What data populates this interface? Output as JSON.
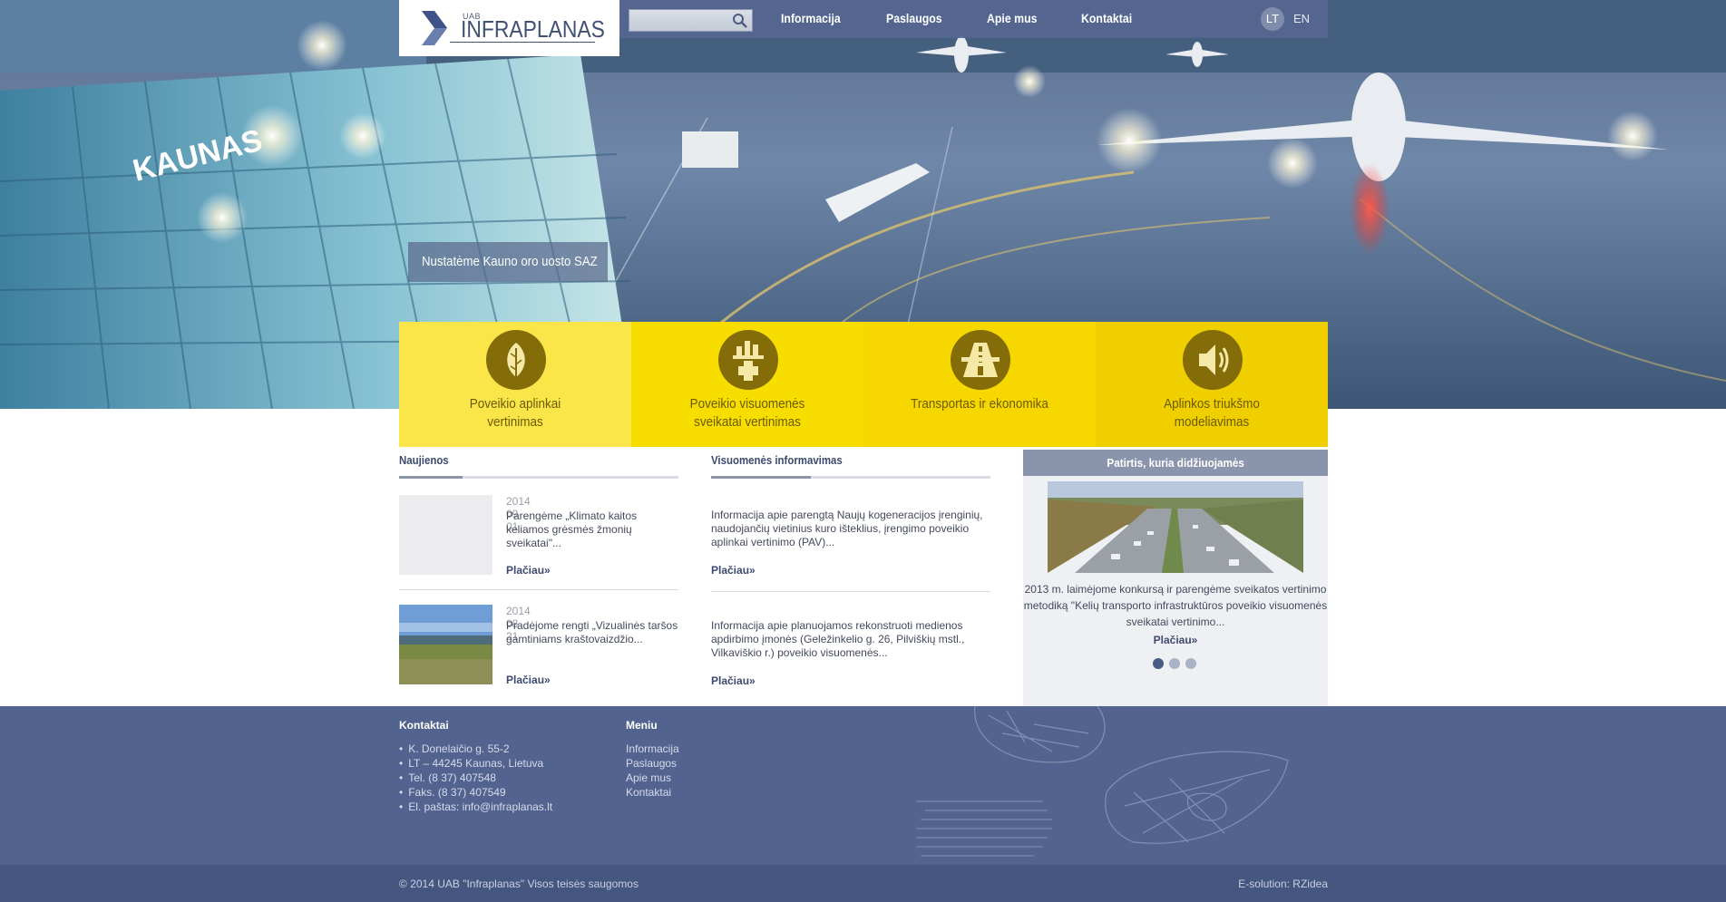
{
  "brand": {
    "prefix": "UAB",
    "name": "INFRAPLANAS"
  },
  "search": {
    "placeholder": "",
    "value": ""
  },
  "nav": {
    "items": [
      "Informacija",
      "Paslaugos",
      "Apie mus",
      "Kontaktai"
    ]
  },
  "languages": {
    "active": "LT",
    "other": "EN"
  },
  "hero": {
    "sign_text": "KAUNAS",
    "caption": "Nustatėme Kauno oro uosto SAZ"
  },
  "services": [
    {
      "label_line1": "Poveikio aplinkai",
      "label_line2": "vertinimas",
      "icon": "leaf-icon",
      "color": "#fbe64a"
    },
    {
      "label_line1": "Poveikio visuomenės",
      "label_line2": "sveikatai vertinimas",
      "icon": "health-factory-icon",
      "color": "#f8dd00"
    },
    {
      "label_line1": "Transportas ir ekonomika",
      "label_line2": "",
      "icon": "road-icon",
      "color": "#f6d800"
    },
    {
      "label_line1": "Aplinkos triukšmo",
      "label_line2": "modeliavimas",
      "icon": "speaker-icon",
      "color": "#f0cf00"
    }
  ],
  "news": {
    "title": "Naujienos",
    "items": [
      {
        "date": "2014 09 01",
        "text": "Parengėme „Klimato kaitos keliamos grėsmės žmonių sveikatai\"...",
        "more": "Plačiau»"
      },
      {
        "date": "2014 08 21",
        "text": "Pradėjome rengti „Vizualinės taršos gamtiniams kraštovaizdžio...",
        "more": "Plačiau»"
      }
    ]
  },
  "public_info": {
    "title": "Visuomenės informavimas",
    "items": [
      {
        "text": "Informacija apie parengtą Naujų kogeneracijos įrenginių, naudojančių vietinius kuro išteklius, įrengimo poveikio aplinkai vertinimo (PAV)...",
        "more": "Plačiau»"
      },
      {
        "text": "Informacija apie planuojamos rekonstruoti medienos apdirbimo įmonės (Geležinkelio g. 26, Pilviškių mstl., Vilkaviškio r.) poveikio visuomenės...",
        "more": "Plačiau»"
      }
    ]
  },
  "experience": {
    "title": "Patirtis, kuria didžiuojamės",
    "text": "2013 m. laimėjome konkursą ir parengėme sveikatos vertinimo metodiką \"Kelių transporto infrastruktūros poveikio visuomenės sveikatai vertinimo...",
    "more": "Plačiau»",
    "slides_count": 3,
    "active_slide": 1
  },
  "footer": {
    "contacts_title": "Kontaktai",
    "contacts": [
      "K. Donelaičio g. 55-2",
      "LT – 44245 Kaunas, Lietuva",
      "Tel. (8 37) 407548",
      "Faks. (8 37) 407549",
      "El. paštas: info@infraplanas.lt"
    ],
    "menu_title": "Meniu",
    "menu": [
      "Informacija",
      "Paslaugos",
      "Apie mus",
      "Kontaktai"
    ],
    "copyright": "© 2014 UAB \"Infraplanas\" Visos teisės saugomos",
    "credit": "E-solution: RZidea"
  },
  "colors": {
    "topbar": "#566792",
    "footer": "#53638f",
    "copy_bar": "#455680",
    "icon_circle": "#846c08",
    "accent_text": "#3c4a6e"
  }
}
